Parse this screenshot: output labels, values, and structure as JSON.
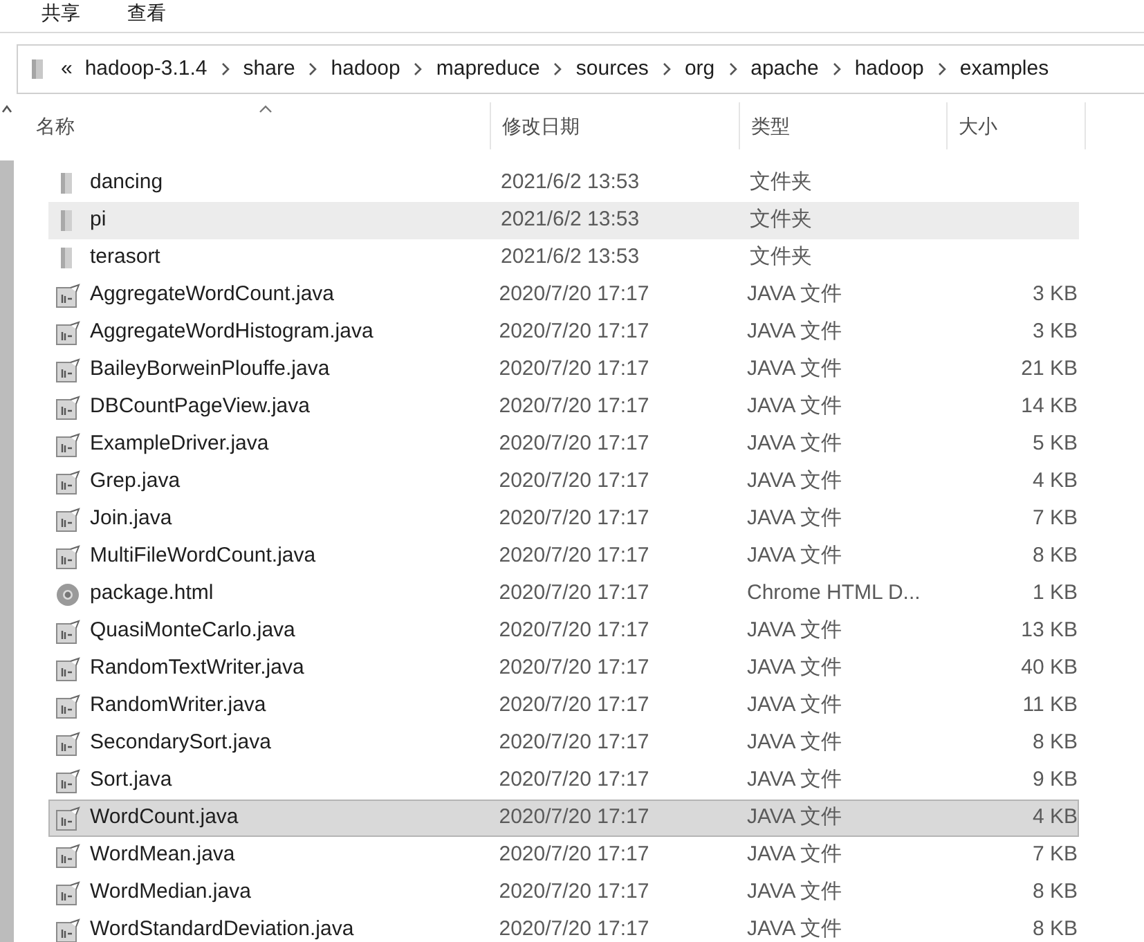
{
  "ribbon_tabs": [
    {
      "label": "共享"
    },
    {
      "label": "查看"
    }
  ],
  "address_bar": {
    "overflow": "«",
    "crumbs": [
      "hadoop-3.1.4",
      "share",
      "hadoop",
      "mapreduce",
      "sources",
      "org",
      "apache",
      "hadoop",
      "examples"
    ]
  },
  "table": {
    "columns": [
      "名称",
      "修改日期",
      "类型",
      "大小"
    ],
    "rows": [
      {
        "kind": "folder",
        "name": "dancing",
        "modified": "2021/6/2 13:53",
        "type": "文件夹",
        "size": "",
        "selected": false,
        "hovered": false
      },
      {
        "kind": "folder",
        "name": "pi",
        "modified": "2021/6/2 13:53",
        "type": "文件夹",
        "size": "",
        "selected": false,
        "hovered": true
      },
      {
        "kind": "folder",
        "name": "terasort",
        "modified": "2021/6/2 13:53",
        "type": "文件夹",
        "size": "",
        "selected": false,
        "hovered": false
      },
      {
        "kind": "java",
        "name": "AggregateWordCount.java",
        "modified": "2020/7/20 17:17",
        "type": "JAVA 文件",
        "size": "3 KB",
        "selected": false,
        "hovered": false
      },
      {
        "kind": "java",
        "name": "AggregateWordHistogram.java",
        "modified": "2020/7/20 17:17",
        "type": "JAVA 文件",
        "size": "3 KB",
        "selected": false,
        "hovered": false
      },
      {
        "kind": "java",
        "name": "BaileyBorweinPlouffe.java",
        "modified": "2020/7/20 17:17",
        "type": "JAVA 文件",
        "size": "21 KB",
        "selected": false,
        "hovered": false
      },
      {
        "kind": "java",
        "name": "DBCountPageView.java",
        "modified": "2020/7/20 17:17",
        "type": "JAVA 文件",
        "size": "14 KB",
        "selected": false,
        "hovered": false
      },
      {
        "kind": "java",
        "name": "ExampleDriver.java",
        "modified": "2020/7/20 17:17",
        "type": "JAVA 文件",
        "size": "5 KB",
        "selected": false,
        "hovered": false
      },
      {
        "kind": "java",
        "name": "Grep.java",
        "modified": "2020/7/20 17:17",
        "type": "JAVA 文件",
        "size": "4 KB",
        "selected": false,
        "hovered": false
      },
      {
        "kind": "java",
        "name": "Join.java",
        "modified": "2020/7/20 17:17",
        "type": "JAVA 文件",
        "size": "7 KB",
        "selected": false,
        "hovered": false
      },
      {
        "kind": "java",
        "name": "MultiFileWordCount.java",
        "modified": "2020/7/20 17:17",
        "type": "JAVA 文件",
        "size": "8 KB",
        "selected": false,
        "hovered": false
      },
      {
        "kind": "html",
        "name": "package.html",
        "modified": "2020/7/20 17:17",
        "type": "Chrome HTML D...",
        "size": "1 KB",
        "selected": false,
        "hovered": false
      },
      {
        "kind": "java",
        "name": "QuasiMonteCarlo.java",
        "modified": "2020/7/20 17:17",
        "type": "JAVA 文件",
        "size": "13 KB",
        "selected": false,
        "hovered": false
      },
      {
        "kind": "java",
        "name": "RandomTextWriter.java",
        "modified": "2020/7/20 17:17",
        "type": "JAVA 文件",
        "size": "40 KB",
        "selected": false,
        "hovered": false
      },
      {
        "kind": "java",
        "name": "RandomWriter.java",
        "modified": "2020/7/20 17:17",
        "type": "JAVA 文件",
        "size": "11 KB",
        "selected": false,
        "hovered": false
      },
      {
        "kind": "java",
        "name": "SecondarySort.java",
        "modified": "2020/7/20 17:17",
        "type": "JAVA 文件",
        "size": "8 KB",
        "selected": false,
        "hovered": false
      },
      {
        "kind": "java",
        "name": "Sort.java",
        "modified": "2020/7/20 17:17",
        "type": "JAVA 文件",
        "size": "9 KB",
        "selected": false,
        "hovered": false
      },
      {
        "kind": "java",
        "name": "WordCount.java",
        "modified": "2020/7/20 17:17",
        "type": "JAVA 文件",
        "size": "4 KB",
        "selected": true,
        "hovered": false
      },
      {
        "kind": "java",
        "name": "WordMean.java",
        "modified": "2020/7/20 17:17",
        "type": "JAVA 文件",
        "size": "7 KB",
        "selected": false,
        "hovered": false
      },
      {
        "kind": "java",
        "name": "WordMedian.java",
        "modified": "2020/7/20 17:17",
        "type": "JAVA 文件",
        "size": "8 KB",
        "selected": false,
        "hovered": false
      },
      {
        "kind": "java",
        "name": "WordStandardDeviation.java",
        "modified": "2020/7/20 17:17",
        "type": "JAVA 文件",
        "size": "8 KB",
        "selected": false,
        "hovered": false
      }
    ]
  }
}
